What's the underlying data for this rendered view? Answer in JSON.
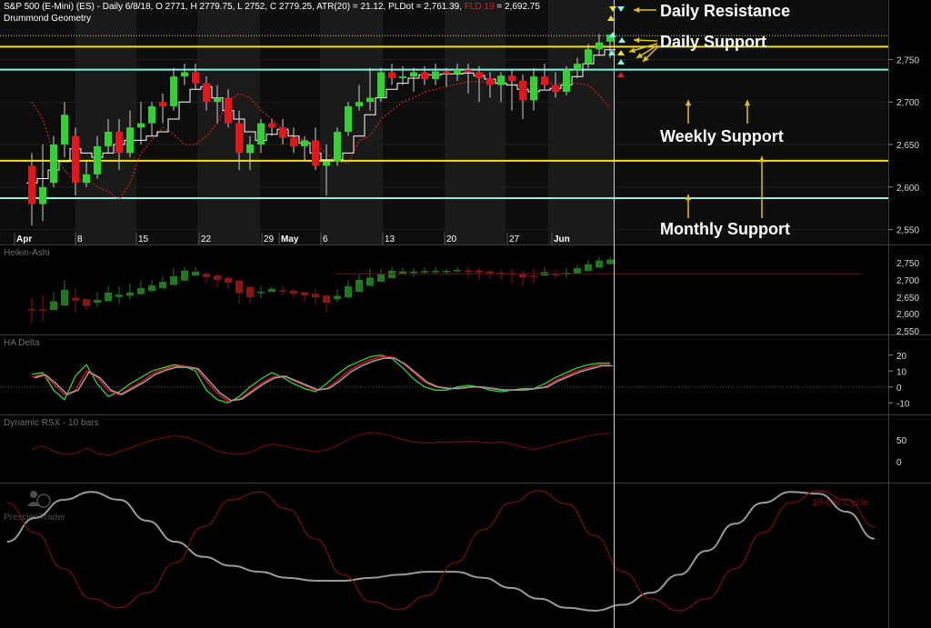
{
  "header": {
    "line1_prefix": "S&P 500 (E-Mini) (ES) - Daily 6/8/18, O 2771, H 2779.75, L 2752, C 2779.25, ATR(20) = 21.12, PLDot = 2,761.39,",
    "line1_fld": "FLD 19",
    "line1_fld_value": "= 2,692.75",
    "line2": "Drummond Geometry"
  },
  "colors": {
    "up_candle": "#30d430",
    "down_candle": "#e8141c",
    "yellow_line": "#f0e020",
    "cyan_line": "#7ff5e6",
    "fld_line": "#cc2222",
    "pldot_line": "#ffffff",
    "ha_up": "#1f7a1f",
    "ha_down": "#8b1414",
    "annotation_arrow": "#e0c020"
  },
  "watermark": {
    "logo": "PrescienTrader"
  },
  "chart_data": [
    {
      "type": "candlestick",
      "panel": "price",
      "x_labels": [
        "Apr",
        "8",
        "15",
        "22",
        "29",
        "May",
        "6",
        "13",
        "20",
        "27",
        "Jun"
      ],
      "y_ticks": [
        "2,750",
        "2,700",
        "2,650",
        "2,600",
        "2,550"
      ],
      "ylim": [
        2540,
        2790
      ],
      "ohlc": [
        [
          2625,
          2640,
          2555,
          2580
        ],
        [
          2580,
          2650,
          2560,
          2600
        ],
        [
          2605,
          2660,
          2600,
          2650
        ],
        [
          2650,
          2700,
          2635,
          2685
        ],
        [
          2660,
          2670,
          2590,
          2605
        ],
        [
          2605,
          2630,
          2600,
          2615
        ],
        [
          2615,
          2660,
          2610,
          2648
        ],
        [
          2648,
          2680,
          2640,
          2665
        ],
        [
          2665,
          2680,
          2620,
          2640
        ],
        [
          2640,
          2690,
          2635,
          2670
        ],
        [
          2670,
          2700,
          2650,
          2675
        ],
        [
          2675,
          2700,
          2660,
          2695
        ],
        [
          2700,
          2710,
          2675,
          2695
        ],
        [
          2695,
          2740,
          2690,
          2730
        ],
        [
          2730,
          2745,
          2720,
          2735
        ],
        [
          2735,
          2745,
          2715,
          2722
        ],
        [
          2722,
          2730,
          2690,
          2700
        ],
        [
          2700,
          2720,
          2675,
          2705
        ],
        [
          2705,
          2715,
          2670,
          2675
        ],
        [
          2675,
          2690,
          2620,
          2640
        ],
        [
          2640,
          2660,
          2620,
          2650
        ],
        [
          2650,
          2680,
          2640,
          2675
        ],
        [
          2675,
          2680,
          2660,
          2670
        ],
        [
          2670,
          2680,
          2650,
          2658
        ],
        [
          2658,
          2670,
          2640,
          2648
        ],
        [
          2648,
          2660,
          2630,
          2655
        ],
        [
          2655,
          2670,
          2620,
          2625
        ],
        [
          2625,
          2650,
          2590,
          2630
        ],
        [
          2630,
          2670,
          2625,
          2665
        ],
        [
          2665,
          2700,
          2660,
          2695
        ],
        [
          2695,
          2720,
          2690,
          2700
        ],
        [
          2700,
          2740,
          2690,
          2705
        ],
        [
          2705,
          2740,
          2700,
          2735
        ],
        [
          2735,
          2745,
          2720,
          2728
        ],
        [
          2728,
          2742,
          2720,
          2730
        ],
        [
          2730,
          2740,
          2712,
          2735
        ],
        [
          2735,
          2742,
          2720,
          2727
        ],
        [
          2727,
          2745,
          2720,
          2736
        ],
        [
          2736,
          2740,
          2718,
          2733
        ],
        [
          2733,
          2745,
          2725,
          2738
        ],
        [
          2738,
          2745,
          2710,
          2735
        ],
        [
          2735,
          2742,
          2700,
          2728
        ],
        [
          2728,
          2735,
          2705,
          2720
        ],
        [
          2720,
          2735,
          2700,
          2731
        ],
        [
          2731,
          2738,
          2690,
          2725
        ],
        [
          2725,
          2732,
          2680,
          2702
        ],
        [
          2702,
          2740,
          2690,
          2730
        ],
        [
          2730,
          2745,
          2715,
          2720
        ],
        [
          2720,
          2735,
          2705,
          2712
        ],
        [
          2712,
          2742,
          2708,
          2738
        ],
        [
          2738,
          2752,
          2728,
          2745
        ],
        [
          2745,
          2768,
          2740,
          2762
        ],
        [
          2762,
          2780,
          2755,
          2770
        ],
        [
          2771,
          2779.75,
          2752,
          2779.25
        ]
      ],
      "pldot": [
        2605,
        2610,
        2620,
        2630,
        2645,
        2640,
        2635,
        2640,
        2650,
        2655,
        2655,
        2660,
        2665,
        2680,
        2700,
        2715,
        2718,
        2705,
        2690,
        2680,
        2665,
        2655,
        2662,
        2668,
        2660,
        2652,
        2640,
        2632,
        2632,
        2640,
        2660,
        2685,
        2705,
        2715,
        2722,
        2728,
        2732,
        2732,
        2733,
        2733,
        2734,
        2731,
        2727,
        2722,
        2720,
        2715,
        2712,
        2714,
        2716,
        2720,
        2730,
        2745,
        2755,
        2761.39
      ],
      "fld": [
        2700,
        2680,
        2640,
        2620,
        2605,
        2610,
        2600,
        2595,
        2585,
        2605,
        2640,
        2655,
        2670,
        2662,
        2650,
        2650,
        2660,
        2675,
        2700,
        2710,
        2705,
        2690,
        2680,
        2668,
        2660,
        2655,
        2650,
        2640,
        2630,
        2628,
        2655,
        2660,
        2680,
        2690,
        2700,
        2705,
        2712,
        2715,
        2718,
        2721,
        2724,
        2724,
        2723,
        2722,
        2722,
        2722,
        2722,
        2722,
        2722,
        2722,
        2722,
        2720,
        2708,
        2692.75
      ],
      "levels": [
        {
          "label": "Daily Resistance",
          "value": 2778,
          "style": "dotted",
          "color": "yellow"
        },
        {
          "label": "Daily Support",
          "value": 2765,
          "style": "solid",
          "color": "yellow"
        },
        {
          "label": "Daily Support",
          "value": 2738,
          "style": "solid",
          "color": "cyan"
        },
        {
          "label": "Weekly Support",
          "value": 2631,
          "style": "solid",
          "color": "yellow"
        },
        {
          "label": "Monthly Support",
          "value": 2587,
          "style": "solid",
          "color": "cyan"
        }
      ],
      "annotations": [
        "Daily Resistance",
        "Daily Support",
        "Weekly Support",
        "Monthly Support"
      ]
    },
    {
      "type": "candlestick",
      "panel": "heikin-ashi",
      "title": "Heikin-Ashi",
      "y_ticks": [
        "2,750",
        "2,700",
        "2,650",
        "2,600",
        "2,550"
      ],
      "ylim": [
        2535,
        2775
      ]
    },
    {
      "type": "line",
      "panel": "ha-delta",
      "title": "HA Delta",
      "y_ticks": [
        "20",
        "10",
        "0",
        "-10"
      ],
      "ylim": [
        -15,
        25
      ],
      "series": [
        {
          "values": [
            8,
            9,
            -2,
            -8,
            7,
            14,
            2,
            -6,
            -3,
            2,
            6,
            10,
            12,
            14,
            13,
            10,
            -2,
            -8,
            -10,
            -6,
            0,
            5,
            9,
            6,
            2,
            -1,
            -3,
            2,
            8,
            13,
            16,
            19,
            20,
            18,
            12,
            5,
            0,
            -2,
            -2,
            0,
            1,
            0,
            -2,
            -3,
            -2,
            -1,
            -1,
            2,
            6,
            9,
            12,
            14,
            15,
            15
          ]
        },
        {
          "values": [
            6,
            8,
            2,
            -5,
            -2,
            10,
            6,
            -2,
            -5,
            -1,
            3,
            8,
            11,
            13,
            13,
            12,
            4,
            -4,
            -9,
            -8,
            -3,
            2,
            6,
            7,
            4,
            1,
            -2,
            -1,
            4,
            10,
            14,
            17,
            19,
            19,
            15,
            9,
            3,
            0,
            -1,
            -1,
            0,
            0,
            -1,
            -2,
            -2,
            -2,
            -1,
            0,
            4,
            7,
            10,
            12,
            14,
            14
          ]
        }
      ]
    },
    {
      "type": "line",
      "panel": "rsx",
      "title": "Dynamic RSX - 10 bars",
      "y_ticks": [
        "50",
        "0"
      ],
      "ylim": [
        -30,
        90
      ],
      "series": [
        {
          "values": [
            40,
            48,
            35,
            28,
            30,
            42,
            30,
            26,
            34,
            42,
            52,
            60,
            66,
            70,
            68,
            60,
            48,
            36,
            30,
            28,
            32,
            44,
            52,
            48,
            42,
            38,
            34,
            38,
            48,
            62,
            72,
            78,
            76,
            70,
            62,
            56,
            54,
            55,
            56,
            57,
            58,
            56,
            54,
            56,
            52,
            45,
            38,
            45,
            52,
            58,
            64,
            70,
            74,
            76
          ]
        }
      ]
    },
    {
      "type": "line",
      "panel": "cycle",
      "title": "19-bar Cycle",
      "series": [
        {
          "values": [
            0.15,
            0.55,
            0.85,
            0.98,
            0.85,
            0.5,
            0.15,
            -0.1,
            -0.25,
            -0.35,
            -0.45,
            -0.5,
            -0.5,
            -0.45,
            -0.4,
            -0.35,
            -0.35,
            -0.45,
            -0.62,
            -0.8,
            -0.95,
            -1.0,
            -0.9,
            -0.7,
            -0.4,
            0,
            0.45,
            0.8,
            0.98,
            0.95,
            0.65,
            0.2
          ]
        },
        {
          "values": [
            0.8,
            0.3,
            -0.3,
            -0.8,
            -0.95,
            -0.7,
            -0.2,
            0.4,
            0.85,
            0.98,
            0.7,
            0.2,
            -0.4,
            -0.85,
            -0.98,
            -0.75,
            -0.2,
            0.35,
            0.8,
            1.0,
            0.78,
            0.25,
            -0.35,
            -0.8,
            -1.0,
            -0.8,
            -0.3,
            0.3,
            0.8,
            1.0,
            0.85,
            0.4
          ]
        }
      ]
    }
  ]
}
